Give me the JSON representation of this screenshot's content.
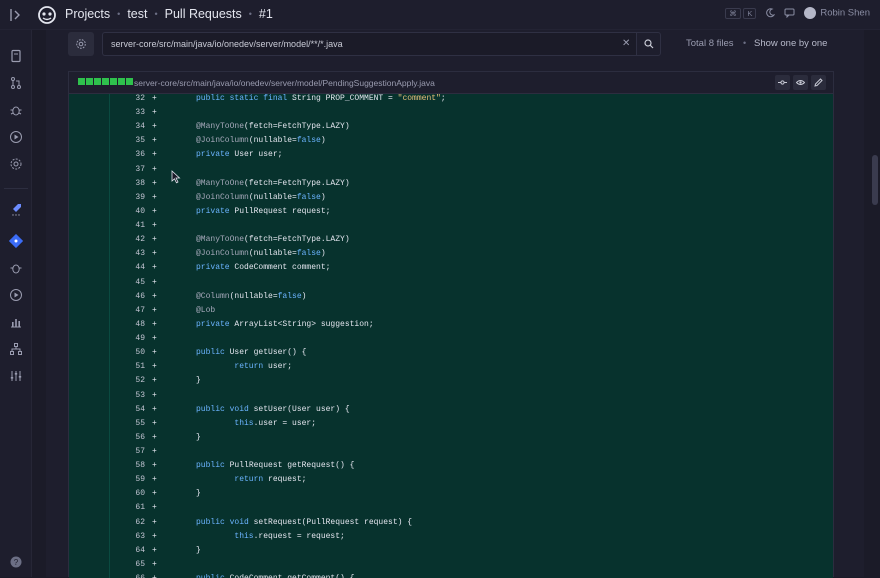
{
  "breadcrumb": {
    "projects": "Projects",
    "project": "test",
    "section": "Pull Requests",
    "number": "#1"
  },
  "topbar": {
    "kbd1": "⌘",
    "kbd2": "K",
    "user": "Robin Shen"
  },
  "toolbar": {
    "path_value": "server-core/src/main/java/io/onedev/server/model/**/*.java",
    "total_files": "Total 8 files",
    "show_one_by_one": "Show one by one"
  },
  "file": {
    "name": "server-core/src/main/java/io/onedev/server/model/PendingSuggestionApply.java",
    "added_blocks": 7
  },
  "colors": {
    "accent": "#2fc14d",
    "code_bg": "#07322d",
    "keyword": "#6bb4ff"
  },
  "lines": [
    {
      "n": "32",
      "html": "<span class=\"kw\">public static final</span> String PROP_COMMENT = <span class=\"str\">\"comment\"</span>;"
    },
    {
      "n": "33",
      "html": ""
    },
    {
      "n": "34",
      "html": "<span class=\"an\">@ManyToOne</span>(fetch=FetchType.LAZY)"
    },
    {
      "n": "35",
      "html": "<span class=\"an\">@JoinColumn</span>(nullable=<span class=\"bl\">false</span>)"
    },
    {
      "n": "36",
      "html": "<span class=\"kw\">private</span> User user;"
    },
    {
      "n": "37",
      "html": ""
    },
    {
      "n": "38",
      "html": "<span class=\"an\">@ManyToOne</span>(fetch=FetchType.LAZY)"
    },
    {
      "n": "39",
      "html": "<span class=\"an\">@JoinColumn</span>(nullable=<span class=\"bl\">false</span>)"
    },
    {
      "n": "40",
      "html": "<span class=\"kw\">private</span> PullRequest request;"
    },
    {
      "n": "41",
      "html": ""
    },
    {
      "n": "42",
      "html": "<span class=\"an\">@ManyToOne</span>(fetch=FetchType.LAZY)"
    },
    {
      "n": "43",
      "html": "<span class=\"an\">@JoinColumn</span>(nullable=<span class=\"bl\">false</span>)"
    },
    {
      "n": "44",
      "html": "<span class=\"kw\">private</span> CodeComment comment;"
    },
    {
      "n": "45",
      "html": ""
    },
    {
      "n": "46",
      "html": "<span class=\"an\">@Column</span>(nullable=<span class=\"bl\">false</span>)"
    },
    {
      "n": "47",
      "html": "<span class=\"an\">@Lob</span>"
    },
    {
      "n": "48",
      "html": "<span class=\"kw\">private</span> ArrayList&lt;String&gt; suggestion;"
    },
    {
      "n": "49",
      "html": ""
    },
    {
      "n": "50",
      "html": "<span class=\"kw\">public</span> User getUser() {"
    },
    {
      "n": "51",
      "html": "        <span class=\"kw\">return</span> user;"
    },
    {
      "n": "52",
      "html": "}"
    },
    {
      "n": "53",
      "html": ""
    },
    {
      "n": "54",
      "html": "<span class=\"kw\">public void</span> setUser(User user) {"
    },
    {
      "n": "55",
      "html": "        <span class=\"kw\">this</span>.user = user;"
    },
    {
      "n": "56",
      "html": "}"
    },
    {
      "n": "57",
      "html": ""
    },
    {
      "n": "58",
      "html": "<span class=\"kw\">public</span> PullRequest getRequest() {"
    },
    {
      "n": "59",
      "html": "        <span class=\"kw\">return</span> request;"
    },
    {
      "n": "60",
      "html": "}"
    },
    {
      "n": "61",
      "html": ""
    },
    {
      "n": "62",
      "html": "<span class=\"kw\">public void</span> setRequest(PullRequest request) {"
    },
    {
      "n": "63",
      "html": "        <span class=\"kw\">this</span>.request = request;"
    },
    {
      "n": "64",
      "html": "}"
    },
    {
      "n": "65",
      "html": ""
    },
    {
      "n": "66",
      "html": "<span class=\"kw\">public</span> CodeComment getComment() {"
    }
  ]
}
